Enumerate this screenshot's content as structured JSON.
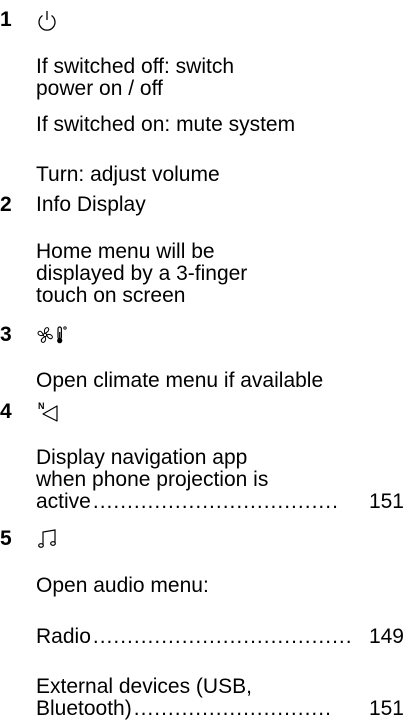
{
  "items": [
    {
      "number": "1",
      "icon": "power-icon",
      "lines": [
        [
          "If switched off: switch",
          "power on / off"
        ],
        [
          "If switched on: mute system"
        ],
        [
          "Turn: adjust volume"
        ]
      ]
    },
    {
      "number": "2",
      "title": "Info Display",
      "lines": [
        [
          "Home menu will be",
          "displayed by a 3-finger",
          "touch on screen"
        ]
      ]
    },
    {
      "number": "3",
      "icon": "climate-icon",
      "lines": [
        [
          "Open climate menu if available"
        ]
      ]
    },
    {
      "number": "4",
      "icon": "navigation-icon",
      "lines": [
        [
          "Display navigation app",
          "when phone projection is"
        ]
      ],
      "ref": {
        "label": "active",
        "dots": "....................................",
        "page": "151"
      }
    },
    {
      "number": "5",
      "icon": "music-icon",
      "lines": [
        [
          "Open audio menu:"
        ]
      ],
      "refs": [
        {
          "label": "Radio",
          "dots": "......................................",
          "page": "149"
        }
      ],
      "ref2": {
        "line1": "External devices (USB,",
        "label": "Bluetooth)",
        "dots": ".............................",
        "page": "151"
      }
    }
  ]
}
